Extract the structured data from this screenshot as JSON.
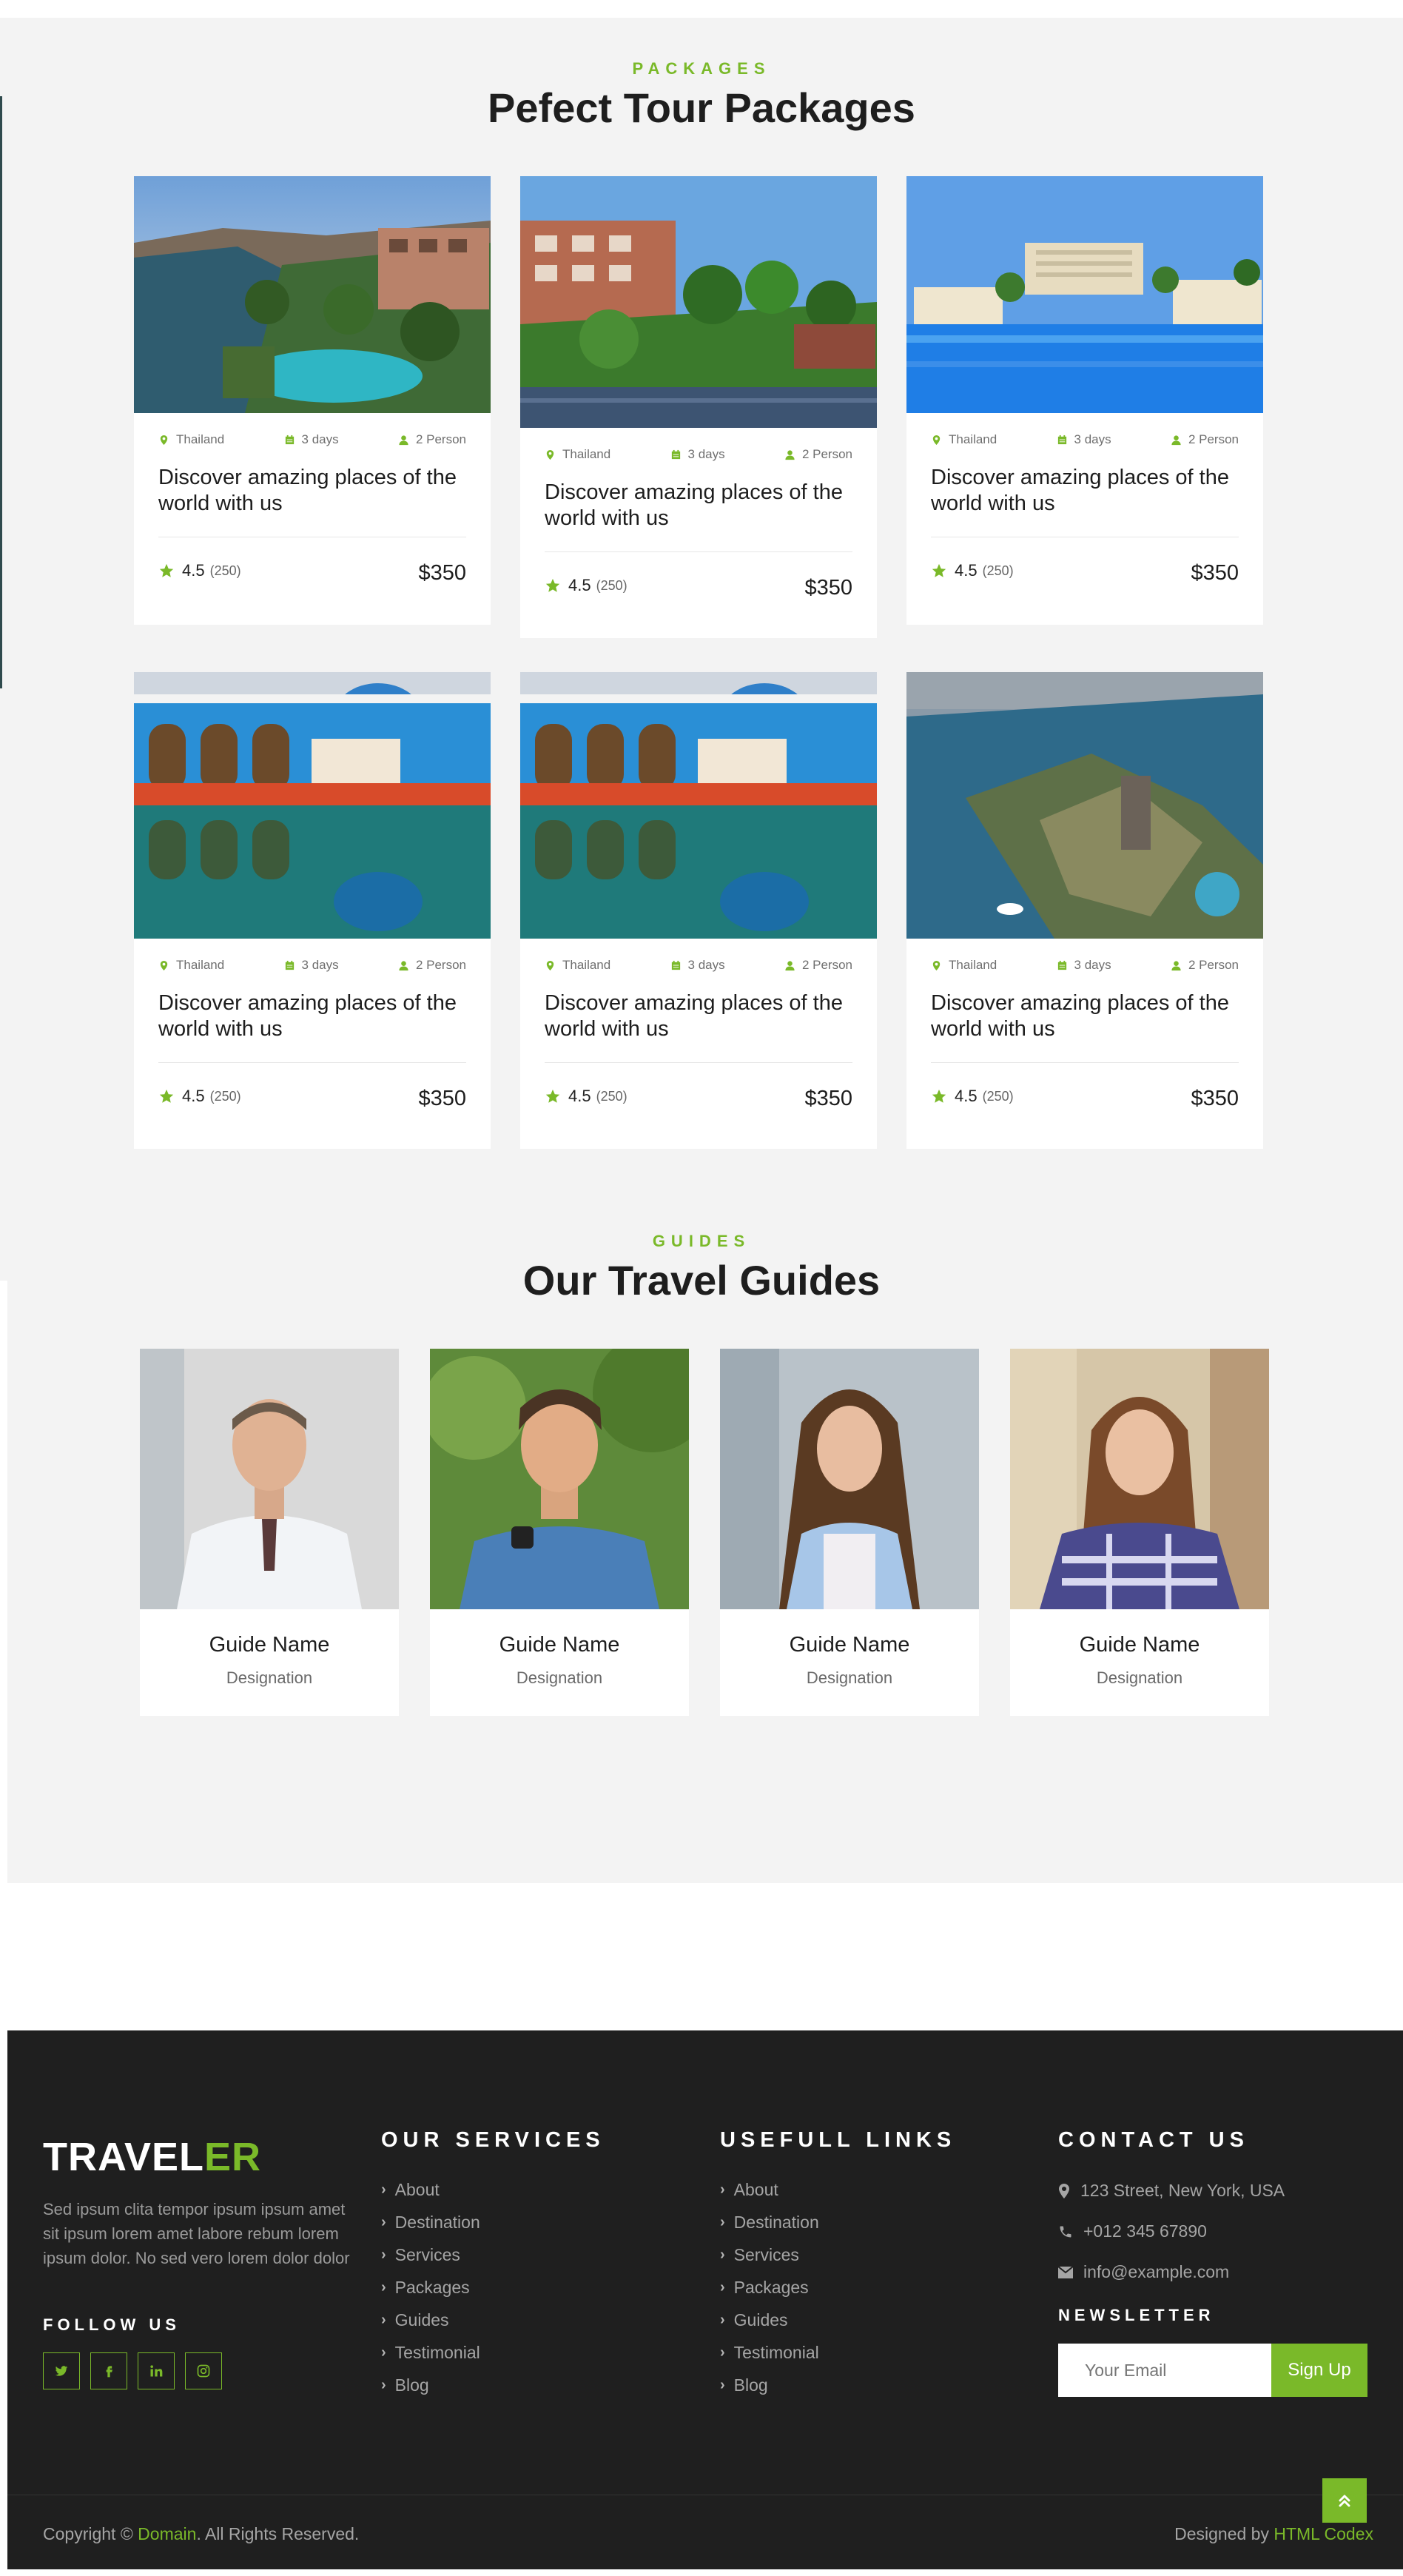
{
  "packages": {
    "eyebrow": "PACKAGES",
    "title": "Pefect Tour Packages",
    "items": [
      {
        "location": "Thailand",
        "duration": "3 days",
        "persons": "2 Person",
        "title": "Discover amazing places of the world with us",
        "rating": "4.5",
        "reviews": "(250)",
        "price": "$350",
        "image": "resort-pool-riverside"
      },
      {
        "location": "Thailand",
        "duration": "3 days",
        "persons": "2 Person",
        "title": "Discover amazing places of the world with us",
        "rating": "4.5",
        "reviews": "(250)",
        "price": "$350",
        "image": "hotel-palm-garden-river"
      },
      {
        "location": "Thailand",
        "duration": "3 days",
        "persons": "2 Person",
        "title": "Discover amazing places of the world with us",
        "rating": "4.5",
        "reviews": "(250)",
        "price": "$350",
        "image": "resort-infinity-pool"
      },
      {
        "location": "Thailand",
        "duration": "3 days",
        "persons": "2 Person",
        "title": "Discover amazing places of the world with us",
        "rating": "4.5",
        "reviews": "(250)",
        "price": "$350",
        "image": "nubian-village-reflection"
      },
      {
        "location": "Thailand",
        "duration": "3 days",
        "persons": "2 Person",
        "title": "Discover amazing places of the world with us",
        "rating": "4.5",
        "reviews": "(250)",
        "price": "$350",
        "image": "nubian-village-reflection"
      },
      {
        "location": "Thailand",
        "duration": "3 days",
        "persons": "2 Person",
        "title": "Discover amazing places of the world with us",
        "rating": "4.5",
        "reviews": "(250)",
        "price": "$350",
        "image": "aerial-island-river"
      }
    ]
  },
  "guides": {
    "eyebrow": "GUIDES",
    "title": "Our Travel Guides",
    "items": [
      {
        "name": "Guide Name",
        "designation": "Designation"
      },
      {
        "name": "Guide Name",
        "designation": "Designation"
      },
      {
        "name": "Guide Name",
        "designation": "Designation"
      },
      {
        "name": "Guide Name",
        "designation": "Designation"
      }
    ]
  },
  "footer": {
    "logo_main": "TRAVEL",
    "logo_accent": "ER",
    "about_text": "Sed ipsum clita tempor ipsum ipsum amet sit ipsum lorem amet labore rebum lorem ipsum dolor. No sed vero lorem dolor dolor",
    "follow_heading": "FOLLOW US",
    "social": [
      "twitter-icon",
      "facebook-icon",
      "linkedin-icon",
      "instagram-icon"
    ],
    "services_heading": "OUR SERVICES",
    "services": [
      "About",
      "Destination",
      "Services",
      "Packages",
      "Guides",
      "Testimonial",
      "Blog"
    ],
    "links_heading": "USEFULL LINKS",
    "links": [
      "About",
      "Destination",
      "Services",
      "Packages",
      "Guides",
      "Testimonial",
      "Blog"
    ],
    "contact_heading": "CONTACT US",
    "address": "123 Street, New York, USA",
    "phone": "+012 345 67890",
    "email": "info@example.com",
    "newsletter_heading": "NEWSLETTER",
    "newsletter_placeholder": "Your Email",
    "signup_label": "Sign Up",
    "copyright_prefix": "Copyright © ",
    "copyright_link": "Domain",
    "copyright_suffix": ". All Rights Reserved.",
    "designed_prefix": "Designed by ",
    "designed_link": "HTML Codex"
  },
  "colors": {
    "accent": "#7ab929",
    "footer_bg": "#1f1f1f",
    "section_bg": "#f3f3f3"
  }
}
